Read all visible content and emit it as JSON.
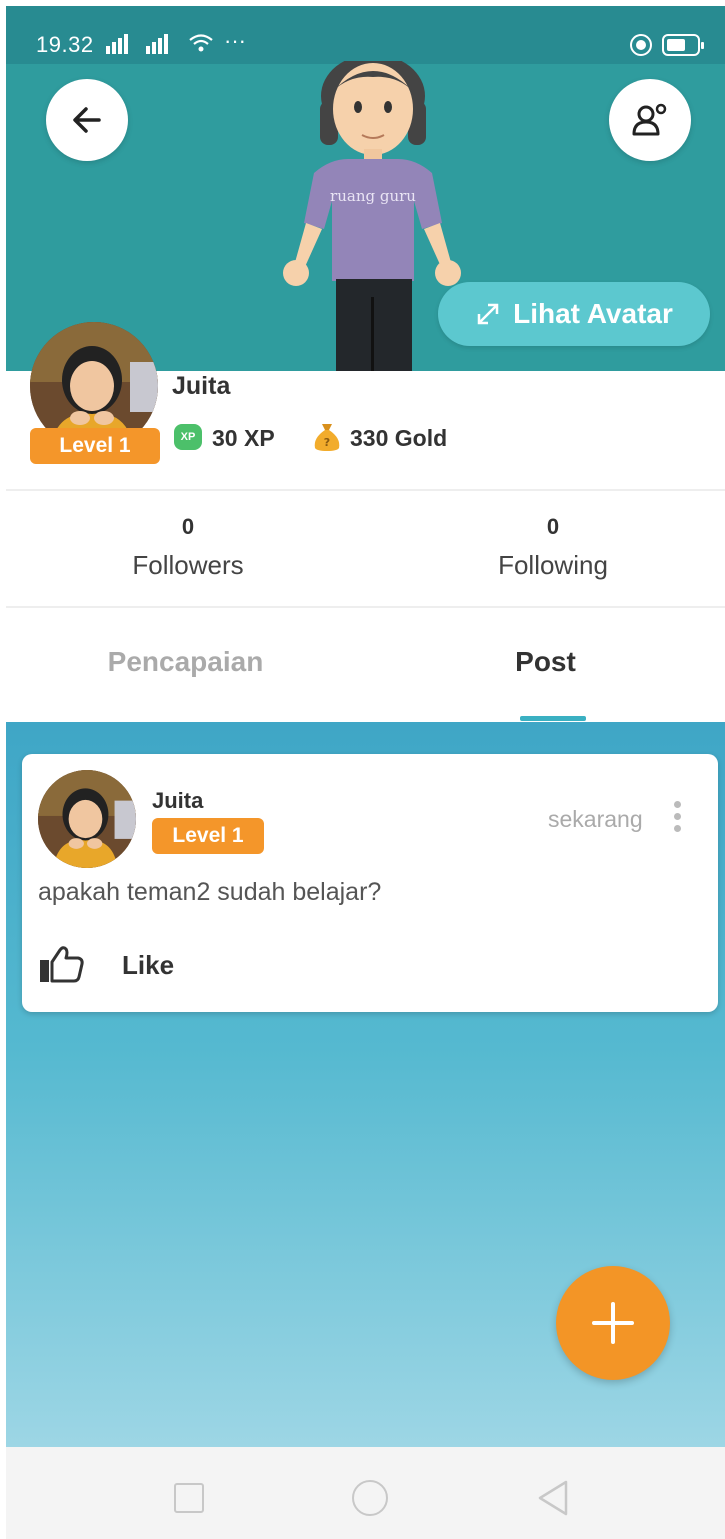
{
  "status_bar": {
    "time": "19.32",
    "more": "···"
  },
  "header": {
    "lihat_avatar_label": "Lihat Avatar",
    "avatar_shirt_text": "ruang guru"
  },
  "profile": {
    "name": "Juita",
    "level": "Level 1",
    "xp": "30 XP",
    "xp_icon_label": "XP",
    "gold": "330 Gold"
  },
  "stats": {
    "followers_count": "0",
    "followers_label": "Followers",
    "following_count": "0",
    "following_label": "Following"
  },
  "tabs": [
    {
      "label": "Pencapaian",
      "active": false
    },
    {
      "label": "Post",
      "active": true
    }
  ],
  "post": {
    "author": "Juita",
    "level": "Level 1",
    "time": "sekarang",
    "text": "apakah teman2 sudah belajar?",
    "like_label": "Like"
  },
  "colors": {
    "header_bg": "#2f9c9e",
    "accent_orange": "#f4962a",
    "tab_indicator": "#3ab0c2",
    "lihat_button": "#5cc8cf"
  },
  "icons": [
    "back-arrow-icon",
    "profile-settings-icon",
    "expand-icon",
    "xp-icon",
    "gold-bag-icon",
    "more-vertical-icon",
    "thumbs-up-icon",
    "plus-icon",
    "nav-recents-icon",
    "nav-home-icon",
    "nav-back-icon"
  ]
}
